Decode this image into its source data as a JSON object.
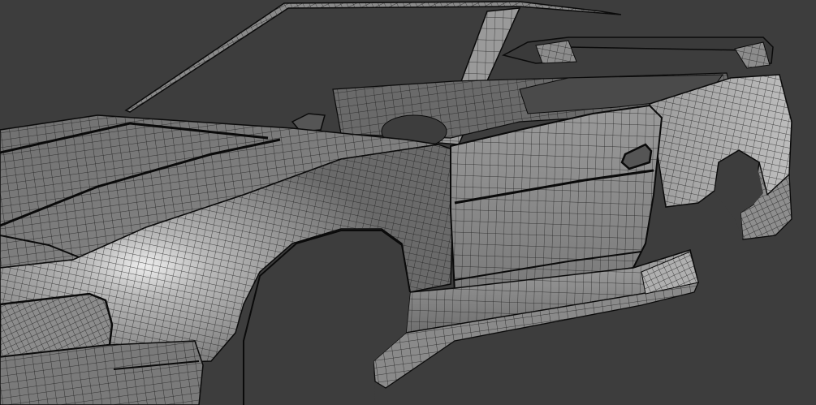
{
  "scene": {
    "background_color": "#3d3d3d",
    "surface_color": "#8f8f8f",
    "surface_highlight_color": "#e6e6e6",
    "surface_shadow_color": "#4a4a4a",
    "wire_color": "#1e1e1e",
    "edge_color": "#0a0a0a",
    "subject": "car-body-wireframe-mesh",
    "style": "viewport-render-with-wireframe-overlay"
  }
}
